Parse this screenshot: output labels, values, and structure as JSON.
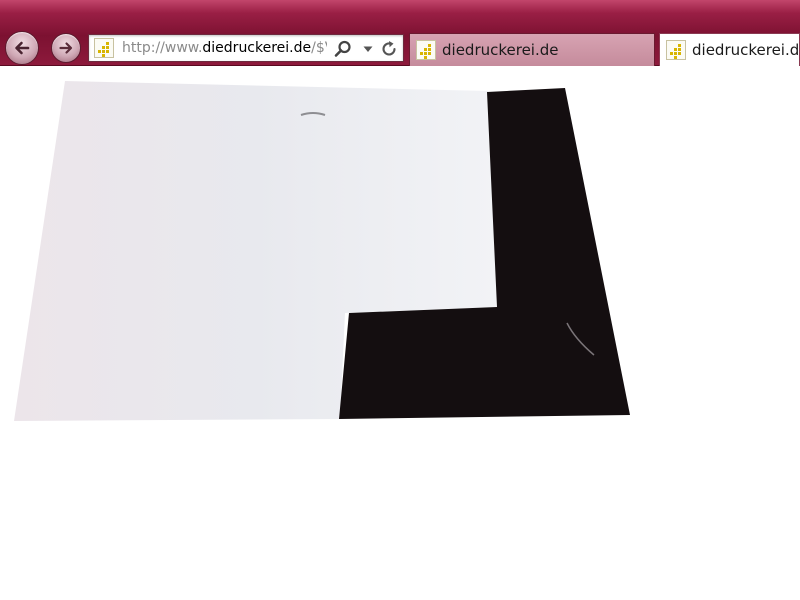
{
  "browser": {
    "address_bar": {
      "url_prefix": "http://www.",
      "url_domain": "diedruckerei.de",
      "url_suffix": "/$V"
    },
    "tabs": [
      {
        "label": "diedruckerei.de",
        "active": false
      },
      {
        "label": "diedruckerei.de",
        "active": true
      }
    ],
    "icons": {
      "back": "back-arrow-icon",
      "forward": "forward-arrow-icon",
      "search": "search-icon",
      "dropdown": "chevron-down-icon",
      "refresh": "refresh-icon",
      "site": "site-favicon"
    },
    "colors": {
      "chrome": "#8d1a3c",
      "favicon_accent": "#d8b500"
    }
  },
  "page": {
    "image": {
      "subject": "folder-photo",
      "colors": {
        "outer_sheet": "#e9eaee",
        "inner_pocket": "#140e10"
      }
    }
  }
}
